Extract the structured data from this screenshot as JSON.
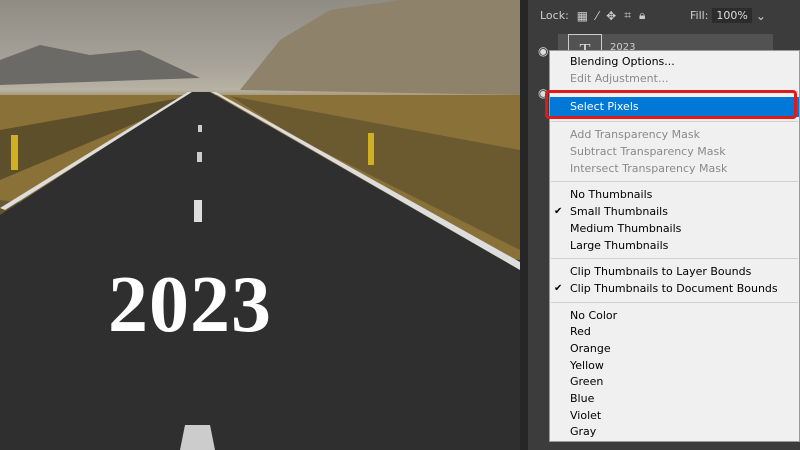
{
  "canvas": {
    "overlay_text": "2023"
  },
  "layers_panel": {
    "lock_label": "Lock:",
    "fill_label": "Fill:",
    "fill_value": "100%",
    "layer_name": "2023",
    "thumb_glyph": "T"
  },
  "context_menu": {
    "groups": [
      [
        {
          "label": "Blending Options...",
          "enabled": true
        },
        {
          "label": "Edit Adjustment...",
          "enabled": false
        }
      ],
      [
        {
          "label": "Select Pixels",
          "enabled": true,
          "highlighted": true
        }
      ],
      [
        {
          "label": "Add Transparency Mask",
          "enabled": false
        },
        {
          "label": "Subtract Transparency Mask",
          "enabled": false
        },
        {
          "label": "Intersect Transparency Mask",
          "enabled": false
        }
      ],
      [
        {
          "label": "No Thumbnails",
          "enabled": true
        },
        {
          "label": "Small Thumbnails",
          "enabled": true,
          "checked": true
        },
        {
          "label": "Medium Thumbnails",
          "enabled": true
        },
        {
          "label": "Large Thumbnails",
          "enabled": true
        }
      ],
      [
        {
          "label": "Clip Thumbnails to Layer Bounds",
          "enabled": true
        },
        {
          "label": "Clip Thumbnails to Document Bounds",
          "enabled": true,
          "checked": true
        }
      ],
      [
        {
          "label": "No Color"
        },
        {
          "label": "Red"
        },
        {
          "label": "Orange"
        },
        {
          "label": "Yellow"
        },
        {
          "label": "Green"
        },
        {
          "label": "Blue"
        },
        {
          "label": "Violet"
        },
        {
          "label": "Gray"
        }
      ]
    ],
    "highlight_color": "#0078d7",
    "annotation_color": "#e01a1a"
  }
}
